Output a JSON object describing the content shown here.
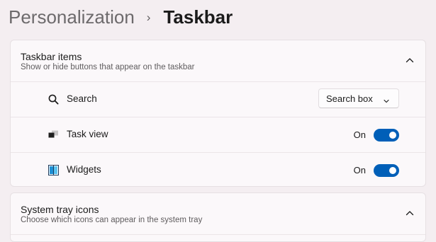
{
  "breadcrumb": {
    "parent": "Personalization",
    "separator": "›",
    "current": "Taskbar"
  },
  "taskbar_items": {
    "title": "Taskbar items",
    "description": "Show or hide buttons that appear on the taskbar",
    "expanded": true,
    "collapse_icon": "chevron-up-icon",
    "rows": [
      {
        "label": "Search",
        "icon": "search-icon",
        "control": "dropdown",
        "value": "Search box"
      },
      {
        "label": "Task view",
        "icon": "task-view-icon",
        "control": "toggle",
        "state_label": "On",
        "on": true
      },
      {
        "label": "Widgets",
        "icon": "widgets-icon",
        "control": "toggle",
        "state_label": "On",
        "on": true
      }
    ]
  },
  "system_tray": {
    "title": "System tray icons",
    "description": "Choose which icons can appear in the system tray",
    "expanded": true,
    "collapse_icon": "chevron-up-icon"
  },
  "colors": {
    "accent": "#005fb8",
    "background": "#f4eef1",
    "card": "#fbf8fa"
  }
}
